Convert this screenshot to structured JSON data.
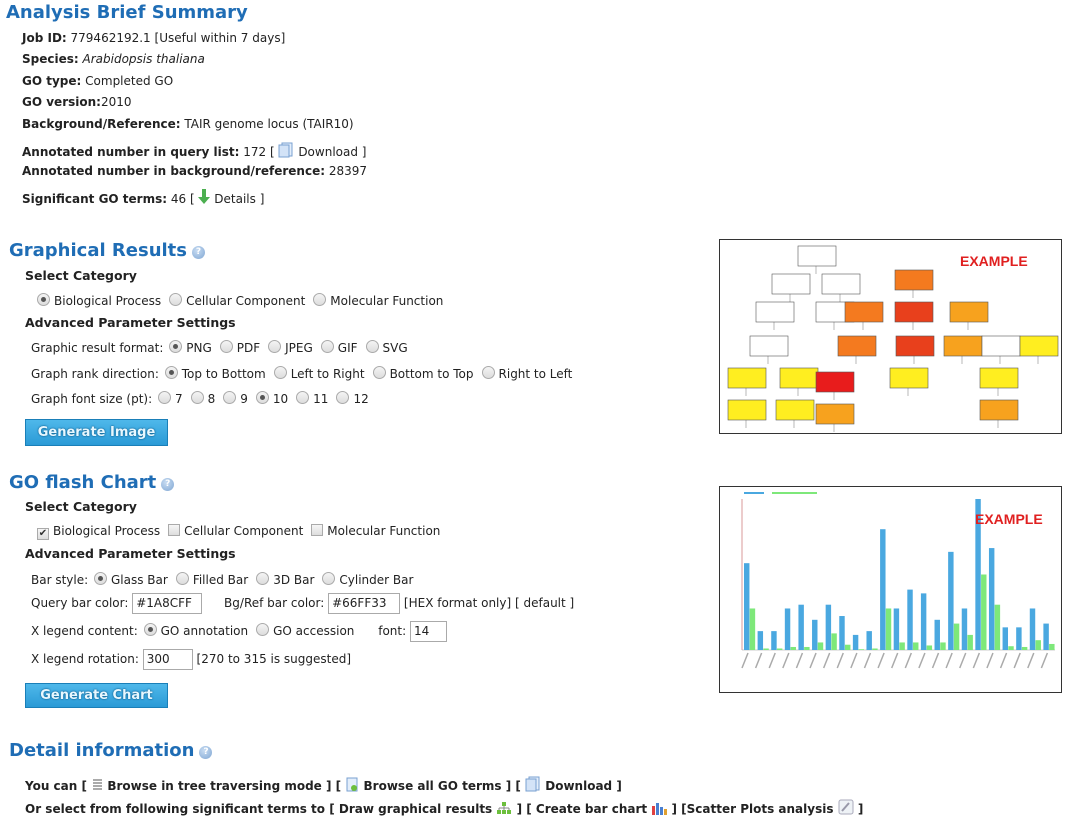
{
  "summary": {
    "title": "Analysis Brief Summary",
    "job_id_label": "Job ID:",
    "job_id": "779462192.1 [Useful within 7 days]",
    "species_label": "Species:",
    "species": "Arabidopsis thaliana",
    "go_type_label": "GO type:",
    "go_type": "Completed GO",
    "go_version_label": "GO version:",
    "go_version": "2010",
    "background_label": "Background/Reference:",
    "background": "TAIR genome locus (TAIR10)",
    "query_label": "Annotated number in query list:",
    "query_count": "172",
    "download_label": "Download",
    "bg_count_label": "Annotated number in background/reference:",
    "bg_count": "28397",
    "sig_label": "Significant GO terms:",
    "sig_count": "46",
    "details_label": "Details"
  },
  "graphical": {
    "title": "Graphical Results",
    "select_category": "Select Category",
    "categories": [
      "Biological Process",
      "Cellular Component",
      "Molecular Function"
    ],
    "selected_category": "Biological Process",
    "advanced": "Advanced Parameter Settings",
    "format_label": "Graphic result format:",
    "formats": [
      "PNG",
      "PDF",
      "JPEG",
      "GIF",
      "SVG"
    ],
    "selected_format": "PNG",
    "rank_label": "Graph rank direction:",
    "ranks": [
      "Top to Bottom",
      "Left to Right",
      "Bottom to Top",
      "Right to Left"
    ],
    "selected_rank": "Top to Bottom",
    "font_label": "Graph font size (pt):",
    "fonts": [
      "7",
      "8",
      "9",
      "10",
      "11",
      "12"
    ],
    "selected_font": "10",
    "button": "Generate Image",
    "example_label": "EXAMPLE"
  },
  "flash": {
    "title": "GO flash Chart",
    "select_category": "Select Category",
    "categories": [
      "Biological Process",
      "Cellular Component",
      "Molecular Function"
    ],
    "checked": [
      true,
      false,
      false
    ],
    "advanced": "Advanced Parameter Settings",
    "bar_style_label": "Bar style:",
    "bar_styles": [
      "Glass Bar",
      "Filled Bar",
      "3D Bar",
      "Cylinder Bar"
    ],
    "selected_bar_style": "Glass Bar",
    "query_color_label": "Query bar color:",
    "query_color": "#1A8CFF",
    "ref_color_label": "Bg/Ref bar color:",
    "ref_color": "#66FF33",
    "hex_note": "[HEX format only]",
    "default_link": "[ default ]",
    "legend_content_label": "X legend content:",
    "legend_contents": [
      "GO annotation",
      "GO accession"
    ],
    "selected_legend_content": "GO annotation",
    "font_label": "font:",
    "font_value": "14",
    "rotation_label": "X legend rotation:",
    "rotation_value": "300",
    "rotation_note": "[270 to 315 is suggested]",
    "button": "Generate Chart",
    "example_label": "EXAMPLE",
    "example_chart": {
      "ylim": [
        0,
        20
      ],
      "query_values": [
        11.5,
        2.5,
        2.5,
        5.5,
        6,
        4,
        6,
        4.5,
        2,
        2.5,
        16,
        5.5,
        8,
        7.5,
        4,
        13,
        5.5,
        20,
        13.5,
        3,
        3,
        5.5,
        3.5
      ],
      "ref_values": [
        5.5,
        0.2,
        0.2,
        0.4,
        0.4,
        1,
        2.2,
        0.7,
        0.1,
        0.2,
        5.5,
        1,
        1,
        0.6,
        1,
        3.5,
        2,
        10,
        6,
        0.5,
        0.4,
        1.3,
        0.8
      ],
      "colors": {
        "query": "#4aa8e0",
        "ref": "#7ee87a"
      }
    }
  },
  "detail": {
    "title": "Detail information",
    "you_can": "You can",
    "browse_tree": "Browse in tree traversing mode",
    "browse_all": "Browse all GO terms",
    "download": "Download",
    "or_select": "Or select from following significant terms to",
    "draw": "Draw graphical results",
    "bar_chart": "Create bar chart",
    "scatter": "Scatter Plots analysis"
  }
}
